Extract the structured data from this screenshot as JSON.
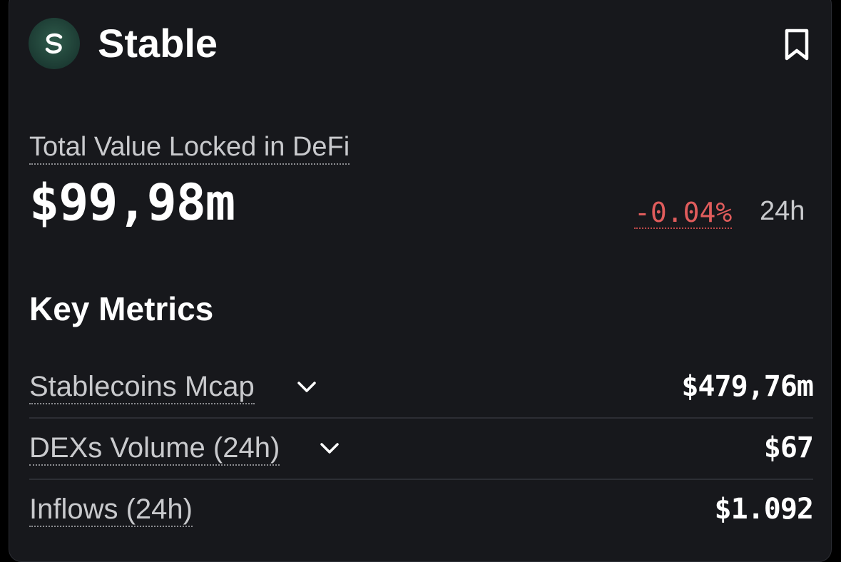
{
  "header": {
    "logo_icon": "stable-s-logo-icon",
    "title": "Stable",
    "bookmark_icon": "bookmark-icon"
  },
  "tvl": {
    "label": "Total Value Locked in DeFi",
    "value": "$99,98m",
    "change": "-0.04%",
    "period": "24h",
    "change_color": "#e05c5c"
  },
  "key_metrics": {
    "title": "Key Metrics",
    "rows": [
      {
        "label": "Stablecoins Mcap",
        "value": "$479,76m",
        "expandable": true
      },
      {
        "label": "DEXs Volume (24h)",
        "value": "$67",
        "expandable": true
      },
      {
        "label": "Inflows (24h)",
        "value": "$1.092",
        "expandable": false
      }
    ]
  }
}
